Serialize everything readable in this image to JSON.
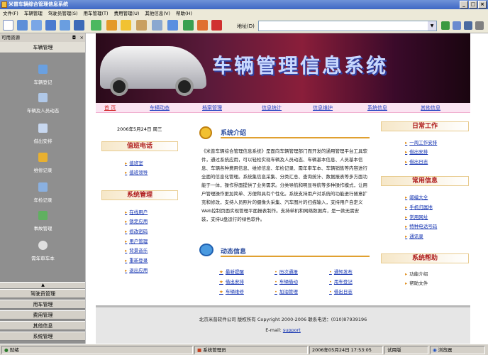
{
  "window": {
    "title": "米普车辆综合管理信息系统",
    "min": "_",
    "max": "□",
    "close": "×"
  },
  "menu": [
    "文件(F)",
    "车辆管理",
    "驾驶员管理(S)",
    "用车管理(T)",
    "费用管理(U)",
    "其他信息(V)",
    "帮助(H)"
  ],
  "address": {
    "label": "地址(D)",
    "value": ""
  },
  "sidebar": {
    "header": "可用资源",
    "close": "×",
    "pin": "◘",
    "section": "车辆管理",
    "items": [
      "车辆登记",
      "车辆及人员动态",
      "借出安排",
      "维修记录",
      "年检记录",
      "事故管理",
      "需年审车本"
    ],
    "tabs": [
      "驾驶员管理",
      "用车管理",
      "费用管理",
      "其他信息",
      "系统管理"
    ]
  },
  "banner": {
    "title": "车辆管理信息系统"
  },
  "nav": [
    "首 页",
    "车辆动态",
    "档案管理",
    "信息统计",
    "信息维护",
    "系统信息",
    "其他信息"
  ],
  "date": "2006年5月24日 周三",
  "duty": {
    "title": "值班电话",
    "items": [
      "值班室",
      "值班领导"
    ]
  },
  "sysmgmt": {
    "title": "系统管理",
    "items": [
      "在线用户",
      "锁定应用",
      "修改密码",
      "用户管理",
      "背景音乐",
      "重新登录",
      "退出应用"
    ]
  },
  "intro": {
    "title": "系统介绍",
    "text": "《米普车辆综合管理信息系统》是面向车辆管理部门而开发的通用管理平台工具软件，通过系统应用，可以轻松实现车辆及人员动态、车辆基本信息、人员基本信息、车辆各种费用信息、维修信息、年检记录、需年审车本、车辆销售等内容进行全面的信息化管理。系统集信息采集、分类汇总、查询统计、数据报表等多方面功能于一体，操作界面提供了业务需求。分类导航和明显导航等多种操作模式，让用户管理操作更加简单、方便和具有个性化。系统支持用户对系统的功能进行随意扩充和修改，支持人员照片的摄像头采集、汽车图片的扫描输入，支持用户自定义Web控制页面实现管理平面报表制作。支持单机和网络数据库，是一款无需安装，支持U盘运行的绿色软件。"
  },
  "news": {
    "title": "动态信息",
    "items": [
      "最新提醒",
      "借出安排",
      "车辆维修",
      "历次通报",
      "车辆借动",
      "加油管理",
      "通知发布",
      "用车登记",
      "借出日志"
    ]
  },
  "daily": {
    "title": "日常工作",
    "items": [
      "一周工作安排",
      "借出安排",
      "借出日志"
    ]
  },
  "common": {
    "title": "常用信息",
    "items": [
      "邮编大全",
      "手机归属地",
      "常用网址",
      "特种电话号码",
      "通讯录"
    ]
  },
  "help": {
    "title": "系统帮助",
    "items": [
      "功能介绍",
      "帮助文件"
    ]
  },
  "footer": {
    "line1": "北京米普软件公司 版权所有 Copyright 2000-2006   联系电话：(010)87939196",
    "email_label": "E-mail:",
    "email": "support"
  },
  "status": {
    "ready": "就绪",
    "task": "系统管理员",
    "datetime": "2006年05月24日 17:53:05",
    "mode": "试用版",
    "browser": "浏览器"
  }
}
